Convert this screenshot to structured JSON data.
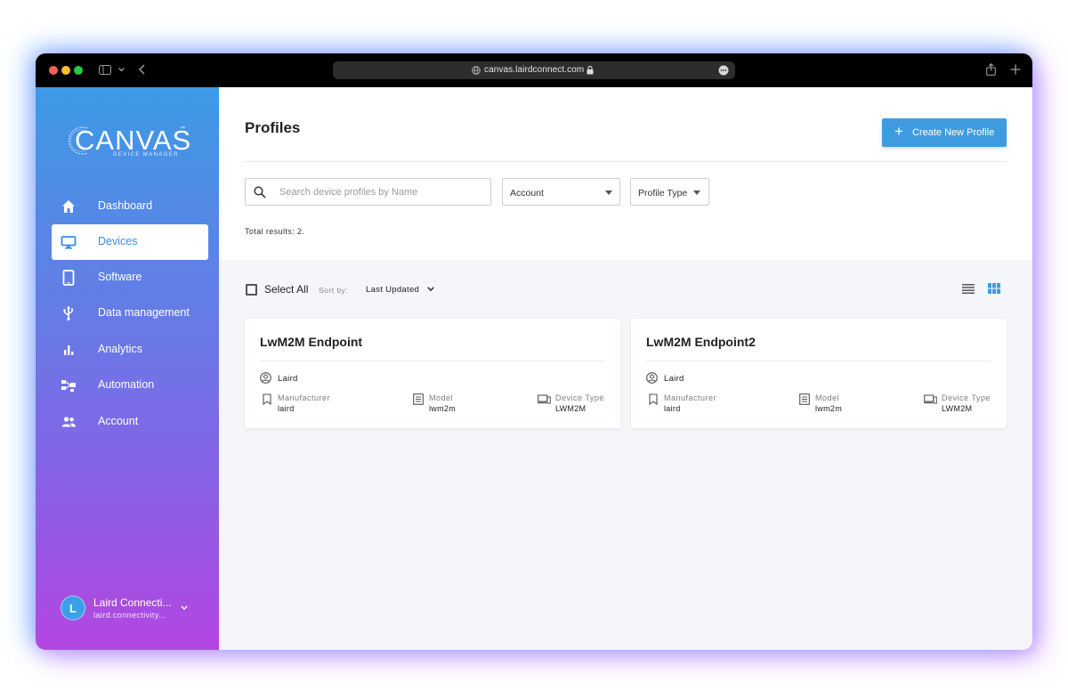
{
  "browser": {
    "url": "canvas.lairdconnect.com"
  },
  "brand": {
    "name": "CANVAS",
    "tagline": "DEVICE MANAGER",
    "trademark": "™"
  },
  "sidebar": {
    "items": [
      {
        "label": "Dashboard",
        "icon": "home-icon"
      },
      {
        "label": "Devices",
        "icon": "monitor-icon",
        "active": true
      },
      {
        "label": "Software",
        "icon": "tablet-icon"
      },
      {
        "label": "Data management",
        "icon": "usb-icon"
      },
      {
        "label": "Analytics",
        "icon": "bar-chart-icon"
      },
      {
        "label": "Automation",
        "icon": "hierarchy-icon"
      },
      {
        "label": "Account",
        "icon": "people-icon"
      }
    ],
    "user": {
      "initial": "L",
      "name": "Laird Connecti...",
      "email": "laird.connectivity..."
    }
  },
  "header": {
    "title": "Profiles",
    "create_label": "Create New Profile"
  },
  "filters": {
    "search_placeholder": "Search device profiles by Name",
    "account_label": "Account",
    "profile_type_label": "Profile Type",
    "total_results": "Total results: 2."
  },
  "toolbar": {
    "select_all": "Select All",
    "sort_by": "Sort by:",
    "sort_value": "Last Updated"
  },
  "cards": [
    {
      "title": "LwM2M Endpoint",
      "owner": "Laird",
      "manufacturer_label": "Manufacturer",
      "manufacturer": "laird",
      "model_label": "Model",
      "model": "lwm2m",
      "device_type_label": "Device Type",
      "device_type": "LWM2M"
    },
    {
      "title": "LwM2M Endpoint2",
      "owner": "Laird",
      "manufacturer_label": "Manufacturer",
      "manufacturer": "laird",
      "model_label": "Model",
      "model": "lwm2m",
      "device_type_label": "Device Type",
      "device_type": "LWM2M"
    }
  ],
  "colors": {
    "accent": "#3f9be0",
    "gradient_top": "#3d9ae6",
    "gradient_bottom": "#b446e0"
  }
}
